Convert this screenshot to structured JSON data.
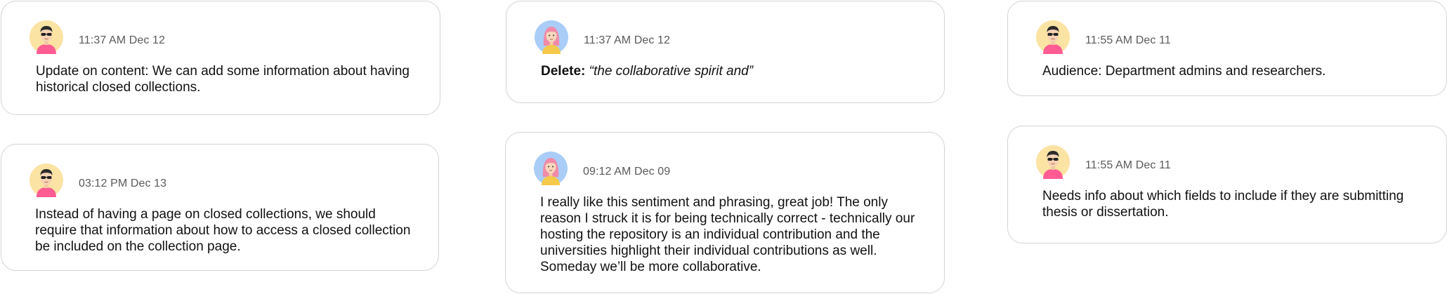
{
  "colors": {
    "card_border": "#d4d4d4",
    "avatar_yellow": "#fbe3a4",
    "avatar_blue": "#a9cdf7"
  },
  "comments": [
    {
      "avatar": "man-sunglasses-avatar",
      "timestamp": "11:37 AM Dec 12",
      "text": "Update on content: We can add some information about having historical closed collections."
    },
    {
      "avatar": "man-sunglasses-avatar",
      "timestamp": "03:12 PM Dec 13",
      "text": "Instead of having a page on closed collections, we should require that information about how to access a closed collection be included on the collection page."
    },
    {
      "avatar": "woman-pink-hair-avatar",
      "timestamp": "11:37 AM Dec 12",
      "delete_label": "Delete:",
      "delete_text": "“the collaborative spirit and”"
    },
    {
      "avatar": "woman-pink-hair-avatar",
      "timestamp": "09:12 AM Dec 09",
      "text": "I really like this sentiment and phrasing, great job! The only reason I struck it is for being technically correct - technically our hosting the repository is an individual contribution and the universities highlight their individual contributions as well. Someday we’ll be more collaborative."
    },
    {
      "avatar": "man-sunglasses-avatar",
      "timestamp": "11:55 AM Dec 11",
      "text": "Audience: Department admins and researchers."
    },
    {
      "avatar": "man-sunglasses-avatar",
      "timestamp": "11:55 AM Dec 11",
      "text": "Needs info about which fields to include if they are submitting thesis or dissertation."
    }
  ]
}
